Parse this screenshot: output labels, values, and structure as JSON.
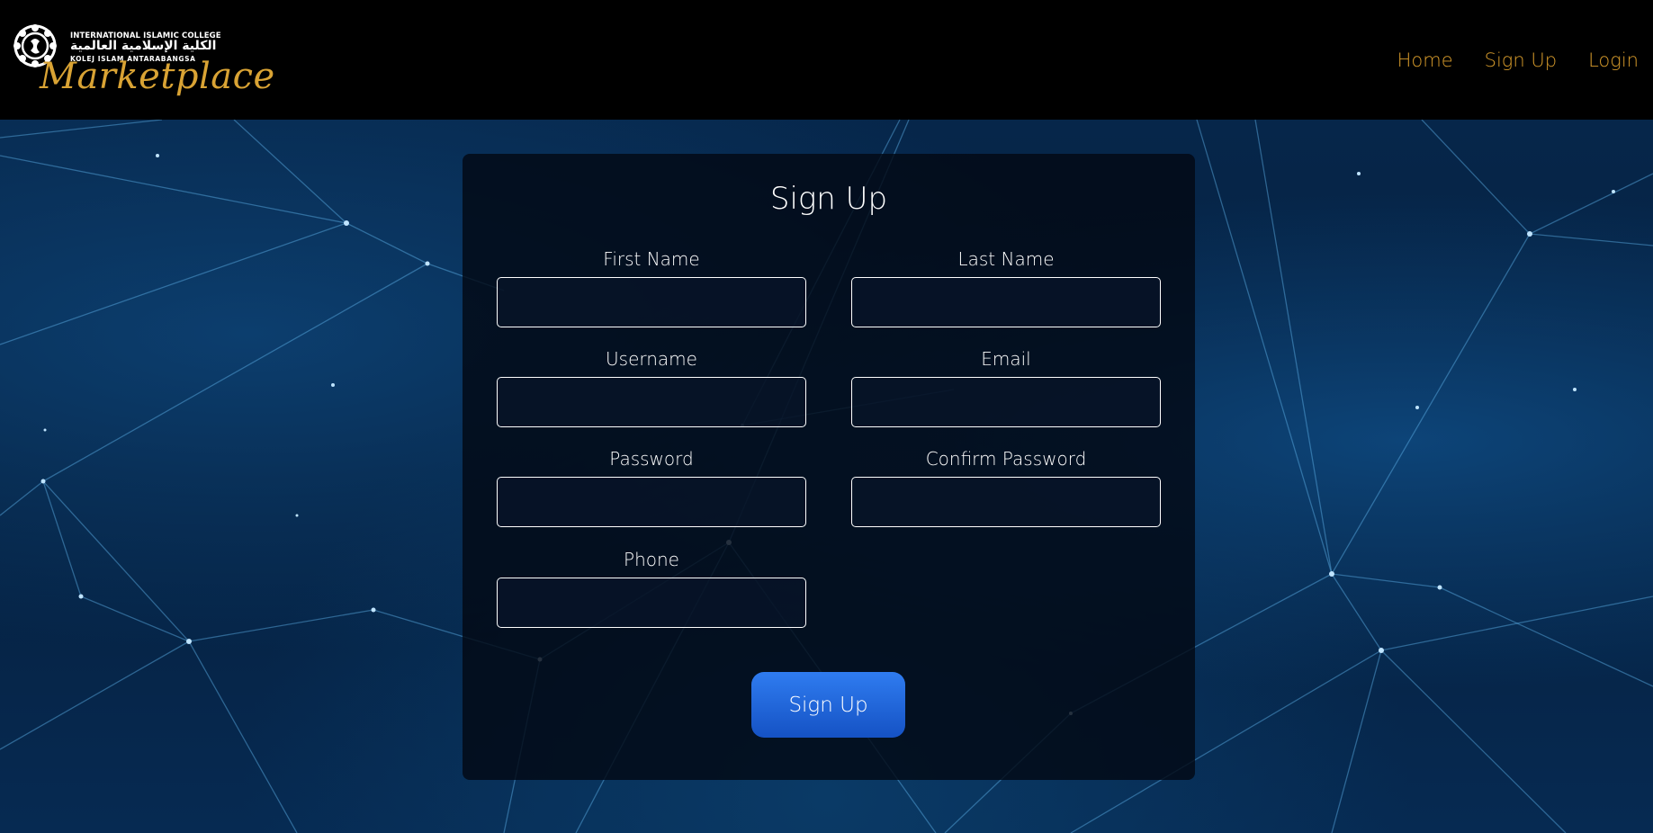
{
  "brand": {
    "college_en": "INTERNATIONAL ISLAMIC COLLEGE",
    "college_ar": "الكلية الإسلامية العالمية",
    "college_ms": "KOLEJ ISLAM ANTARABANGSA",
    "script": "Marketplace",
    "emblem_icon": "college-emblem-icon"
  },
  "nav": {
    "items": [
      {
        "label": "Home"
      },
      {
        "label": "Sign Up"
      },
      {
        "label": "Login"
      }
    ]
  },
  "form": {
    "title": "Sign Up",
    "fields": [
      {
        "label": "First Name",
        "value": "",
        "type": "text"
      },
      {
        "label": "Last Name",
        "value": "",
        "type": "text"
      },
      {
        "label": "Username",
        "value": "",
        "type": "text"
      },
      {
        "label": "Email",
        "value": "",
        "type": "email"
      },
      {
        "label": "Password",
        "value": "",
        "type": "password"
      },
      {
        "label": "Confirm Password",
        "value": "",
        "type": "password"
      },
      {
        "label": "Phone",
        "value": "",
        "type": "tel"
      }
    ],
    "submit_label": "Sign Up"
  },
  "colors": {
    "nav_link": "#d79b2b",
    "brand_script": "#d9a334",
    "button_accent": "#2563eb",
    "background": "#05203f"
  }
}
